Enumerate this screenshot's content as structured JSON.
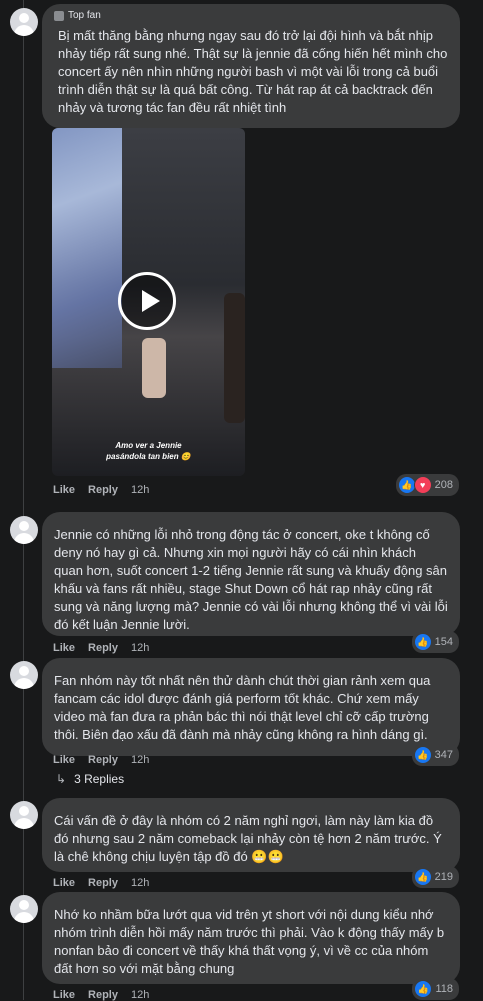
{
  "comments": [
    {
      "badge": "Top fan",
      "text": "Bị mất thăng bằng nhưng ngay sau đó trở lại đội hình và bắt nhịp nhảy tiếp rất sung nhé. Thật sự là jennie đã cống hiến hết mình cho concert ấy nên nhìn những người bash vì một vài lỗi trong cả buổi trình diễn thật sự là quá bất công. Từ hát rap át cả backtrack đến nhảy và tương tác fan đều rất nhiệt tình",
      "video_caption": "Amo ver a Jennie\npasándola tan bien 😊",
      "like": "Like",
      "reply": "Reply",
      "time": "12h",
      "reaction_count": "208"
    },
    {
      "text": "Jennie có những lỗi nhỏ trong động tác ở concert, oke t không cố deny nó hay gì cả. Nhưng xin mọi người hãy có cái nhìn khách quan hơn, suốt concert 1-2 tiếng Jennie rất sung và khuấy động sân khấu và fans rất nhiều, stage Shut Down cổ hát rap nhảy cũng rất sung và năng lượng mà? Jennie có vài lỗi nhưng không thể vì vài lỗi đó kết luận Jennie lười.",
      "like": "Like",
      "reply": "Reply",
      "time": "12h",
      "reaction_count": "154"
    },
    {
      "text": "Fan nhóm này tốt nhất nên thử dành chút thời gian rảnh xem qua fancam các idol được đánh giá perform tốt khác. Chứ xem mấy video mà fan đưa ra phản bác thì nói thật level chỉ cỡ cấp trường thôi. Biên đạo xấu đã đành mà nhảy cũng không ra hình dáng gì.",
      "like": "Like",
      "reply": "Reply",
      "time": "12h",
      "reaction_count": "347",
      "replies_label": "3 Replies"
    },
    {
      "text": "Cái vấn đề ở đây là nhóm có 2 năm nghỉ ngơi, làm này làm kia đồ đó nhưng sau 2 năm comeback lại nhảy còn tệ hơn 2 năm trước. Ý là chê không chịu luyện tập đồ đó 😬😬",
      "like": "Like",
      "reply": "Reply",
      "time": "12h",
      "reaction_count": "219"
    },
    {
      "text": "Nhớ ko nhầm bữa lướt qua vid trên yt short với nội dung kiểu nhớ nhóm trình diễn hồi mấy năm trước thì phải. Vào k động thấy mấy b nonfan bảo đi concert về thấy khá thất vọng ý, vì về cc của nhóm đất hơn so với mặt bằng chung",
      "like": "Like",
      "reply": "Reply",
      "time": "12h",
      "reaction_count": "118"
    }
  ],
  "icons": {
    "top_fan_badge": "diamond-badge-icon",
    "play": "play-icon",
    "like_reaction": "thumbs-up-icon",
    "love_reaction": "heart-icon",
    "reply_arrow": "reply-arrow-icon"
  },
  "colors": {
    "background": "#18191a",
    "bubble": "#3a3b3c",
    "like_blue": "#1877f2",
    "love_red": "#f33e58",
    "muted_text": "#b0b3b8"
  }
}
